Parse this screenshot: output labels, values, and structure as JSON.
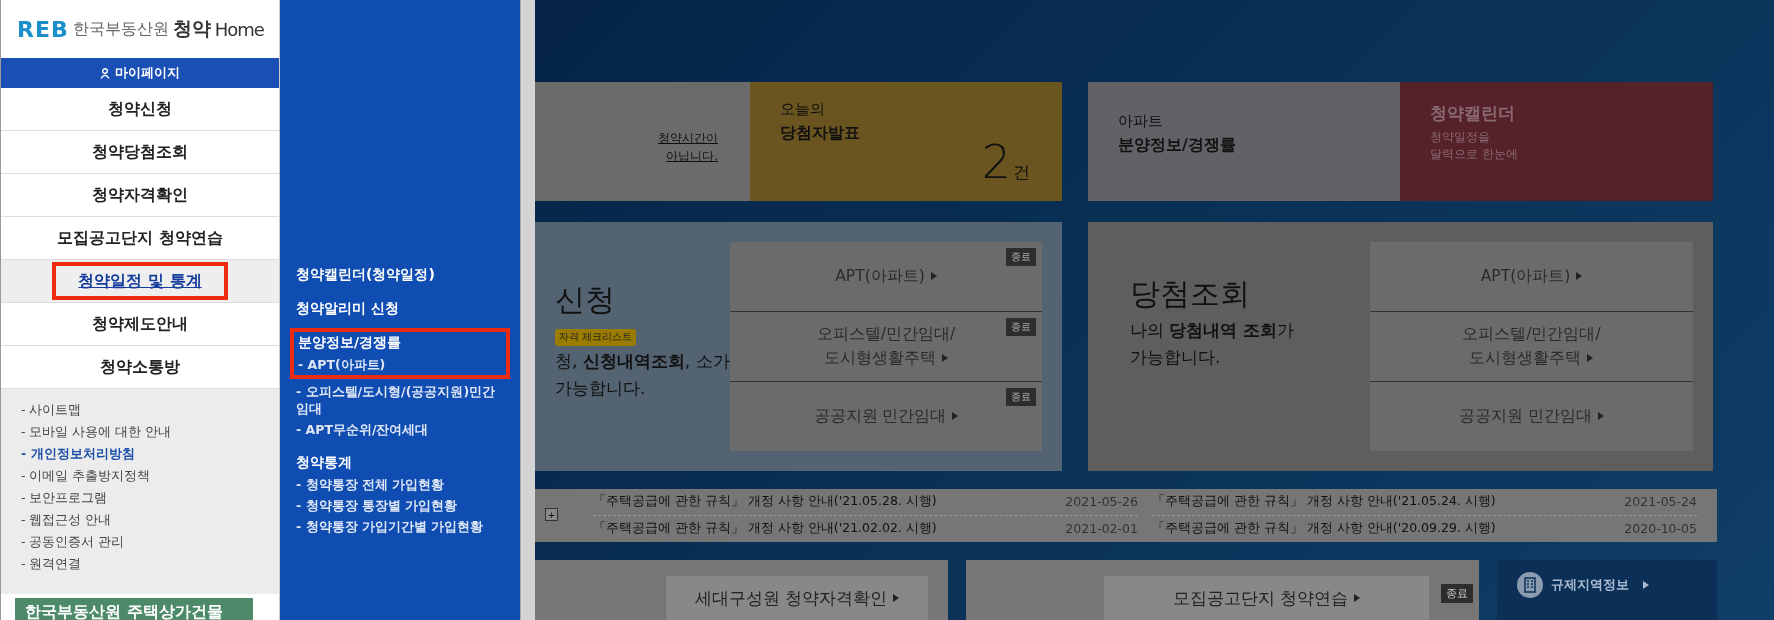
{
  "sidebar": {
    "logo": {
      "mark": "REB",
      "org": "한국부동산원",
      "brand": "청약",
      "home": "Home"
    },
    "mypage": "마이페이지",
    "menu": [
      {
        "label": "청약신청",
        "selected": false,
        "highlighted": false
      },
      {
        "label": "청약당첨조회",
        "selected": false,
        "highlighted": false
      },
      {
        "label": "청약자격확인",
        "selected": false,
        "highlighted": false
      },
      {
        "label": "모집공고단지 청약연습",
        "selected": false,
        "highlighted": false
      },
      {
        "label": "청약일정 및 통계",
        "selected": true,
        "highlighted": true
      },
      {
        "label": "청약제도안내",
        "selected": false,
        "highlighted": false
      },
      {
        "label": "청약소통방",
        "selected": false,
        "highlighted": false
      }
    ],
    "links": [
      {
        "label": "- 사이트맵",
        "emphasized": false
      },
      {
        "label": "- 모바일 사용에 대한 안내",
        "emphasized": false
      },
      {
        "label": "- 개인정보처리방침",
        "emphasized": true
      },
      {
        "label": "- 이메일 추출방지정책",
        "emphasized": false
      },
      {
        "label": "- 보안프로그램",
        "emphasized": false
      },
      {
        "label": "- 웹접근성 안내",
        "emphasized": false
      },
      {
        "label": "- 공동인증서 관리",
        "emphasized": false
      },
      {
        "label": "- 원격연결",
        "emphasized": false
      }
    ],
    "banner": "한국부동산원 주택상가건물"
  },
  "submenu": {
    "sections": [
      {
        "title": "청약캘린더(청약일정)",
        "highlighted": false
      },
      {
        "title": "청약알리미 신청",
        "highlighted": false
      },
      {
        "title": "분양정보/경쟁률",
        "highlighted": true,
        "links": [
          "- APT(아파트)",
          "- 오피스텔/도시형/(공공지원)민간임대",
          "- APT무순위/잔여세대"
        ]
      },
      {
        "title": "청약통계",
        "highlighted": false,
        "links": [
          "- 청약통장 전체 가입현황",
          "- 청약통장 통장별 가입현황",
          "- 청약통장 가입기간별 가입현황"
        ]
      }
    ]
  },
  "main": {
    "top_cards": [
      {
        "kind": "notice",
        "text": "청약시간이 아닙니다."
      },
      {
        "kind": "count",
        "label": "오늘의",
        "title": "당첨자발표",
        "count": "2",
        "unit": "건"
      },
      {
        "kind": "info",
        "label": "아파트",
        "title": "분양정보/경쟁률"
      },
      {
        "kind": "calendar",
        "title": "청약캘린더",
        "desc": "청약일정을 달력으로 한눈에"
      }
    ],
    "panels": [
      {
        "kind": "apply",
        "title": "신청",
        "badge": "자격 체크리스트",
        "desc": "청, **신청내역조회**, 소가 가능합니다.",
        "buttons": [
          {
            "lines": [
              "APT(아파트)"
            ],
            "ended": true,
            "ended_label": "종료"
          },
          {
            "lines": [
              "오피스텔/민간임대/",
              "도시형생활주택"
            ],
            "ended": true,
            "ended_label": "종료"
          },
          {
            "lines": [
              "공공지원 민간임대"
            ],
            "ended": true,
            "ended_label": "종료"
          }
        ]
      },
      {
        "kind": "result",
        "title": "당첨조회",
        "desc": "나의 **당첨내역 조회**가 가능합니다.",
        "buttons": [
          {
            "lines": [
              "APT(아파트)"
            ],
            "ended": false
          },
          {
            "lines": [
              "오피스텔/민간임대/",
              "도시형생활주택"
            ],
            "ended": false
          },
          {
            "lines": [
              "공공지원 민간임대"
            ],
            "ended": false
          }
        ]
      }
    ],
    "news": [
      {
        "title": "「주택공급에 관한 규칙」 개정 사항 안내('21.05.28. 시행)",
        "date": "2021-05-26"
      },
      {
        "title": "「주택공급에 관한 규칙」 개정 사항 안내('21.05.24. 시행)",
        "date": "2021-05-24"
      },
      {
        "title": "「주택공급에 관한 규칙」 개정 사항 안내('21.02.02. 시행)",
        "date": "2021-02-01"
      },
      {
        "title": "「주택공급에 관한 규칙」 개정 사항 안내('20.09.29. 시행)",
        "date": "2020-10-05"
      }
    ],
    "news_more": "+",
    "bottom": [
      {
        "kind": "plain",
        "button": "세대구성원 청약자격확인"
      },
      {
        "kind": "ended",
        "button": "모집공고단지 청약연습",
        "ended_label": "종료"
      },
      {
        "kind": "region",
        "button": "규제지역정보"
      }
    ]
  }
}
